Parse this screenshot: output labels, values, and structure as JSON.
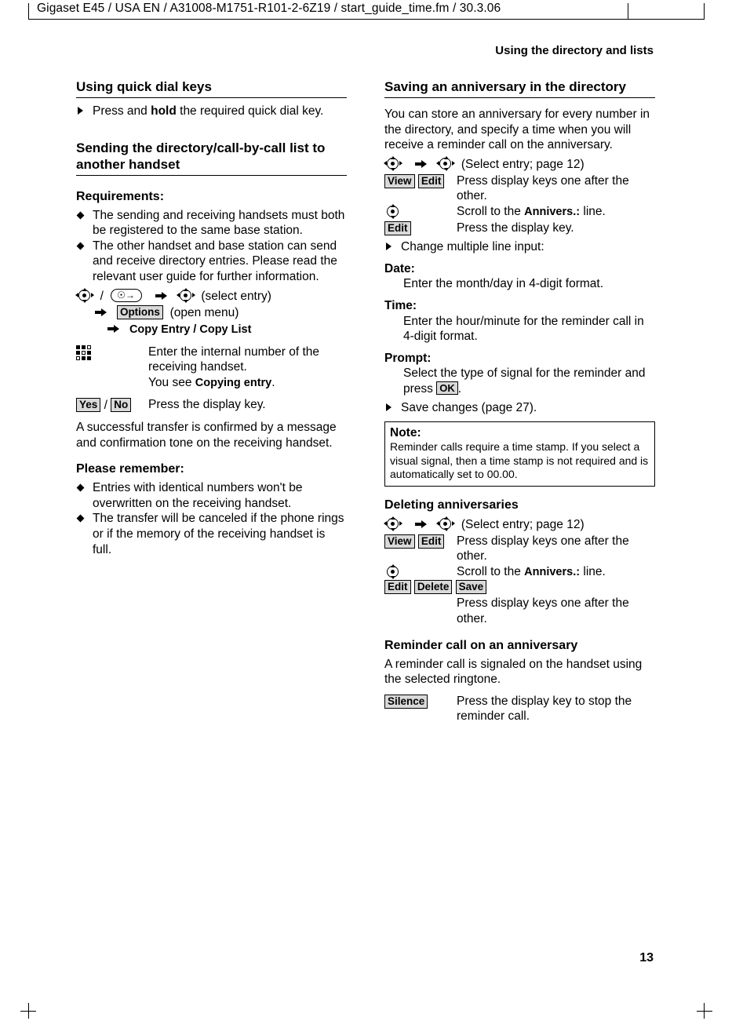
{
  "header": {
    "file_line": "Gigaset E45 / USA EN / A31008-M1751-R101-2-6Z19  / start_guide_time.fm / 30.3.06",
    "running_head": "Using the directory and lists",
    "page_number": "13"
  },
  "left_column": {
    "sec1": {
      "title": "Using quick dial keys",
      "item": "Press and hold the required quick dial key.",
      "item_prefix": "Press and ",
      "item_bold": "hold",
      "item_suffix": " the required quick dial key."
    },
    "sec2": {
      "title": "Sending the directory/call-by-call list to another handset",
      "requirements_title": "Requirements:",
      "bullets": [
        "The sending and receiving handsets must both be registered to the same base station.",
        "The other handset and base station can send and receive directory entries. Please read the relevant user guide for further information."
      ],
      "proc_line1_tail": "(select entry)",
      "proc_line2_chip": "Options",
      "proc_line2_tail": "(open menu)",
      "proc_line3": "Copy Entry / Copy List",
      "keypad_text_1": "Enter the internal number of the receiving handset.",
      "keypad_text_2_prefix": "You see ",
      "keypad_text_2_screen": "Copying entry",
      "keypad_text_2_suffix": ".",
      "yes_chip": "Yes",
      "no_chip": "No",
      "yes_no_text": "Press the display key.",
      "para": "A successful transfer is confirmed by a message and confirmation tone on the receiving handset.",
      "remember_title": "Please remember:",
      "remember_bullets": [
        "Entries with identical numbers won't be overwritten on the receiving handset.",
        "The transfer will be canceled if the phone rings or if the memory of the receiving handset is full."
      ]
    }
  },
  "right_column": {
    "sec1": {
      "title": "Saving an anniversary in the directory",
      "para": "You can store an anniversary for every number in the directory, and specify a time when you will receive a reminder call on the anniversary.",
      "nav_line_tail": "(Select entry; page 12)",
      "row_view_chip": "View",
      "row_edit_chip": "Edit",
      "row_view_edit_text": "Press display keys one after the other.",
      "row_scroll_text_prefix": "Scroll to the ",
      "row_scroll_screen": "Annivers.:",
      "row_scroll_text_suffix": " line.",
      "row_edit_chip2": "Edit",
      "row_edit_text": "Press the display key.",
      "arrow_change": "Change multiple line input:",
      "date_label": "Date:",
      "date_text": "Enter the month/day in 4-digit format.",
      "time_label": "Time:",
      "time_text": "Enter the hour/minute for the reminder call in 4-digit format.",
      "prompt_label": "Prompt:",
      "prompt_text_prefix": "Select the type of signal for the reminder and press ",
      "prompt_ok_chip": "OK",
      "prompt_text_suffix": ".",
      "arrow_save": "Save changes (page 27).",
      "note_title": "Note:",
      "note_text": "Reminder calls require a time stamp. If you select a visual signal, then a time stamp is not required and is automatically set to 00.00."
    },
    "sec2": {
      "title": "Deleting anniversaries",
      "nav_line_tail": "(Select entry; page 12)",
      "row_view_chip": "View",
      "row_edit_chip": "Edit",
      "row_view_edit_text": "Press display keys one after the other.",
      "row_scroll_text_prefix": "Scroll to the ",
      "row_scroll_screen": "Annivers.:",
      "row_scroll_text_suffix": " line.",
      "chips": [
        "Edit",
        "Delete",
        "Save"
      ],
      "chips_text": "Press display keys one after the other."
    },
    "sec3": {
      "title": "Reminder call on an anniversary",
      "para": "A reminder call is signaled on the handset using the selected ringtone.",
      "silence_chip": "Silence",
      "silence_text": "Press the display key to stop the reminder call."
    }
  }
}
